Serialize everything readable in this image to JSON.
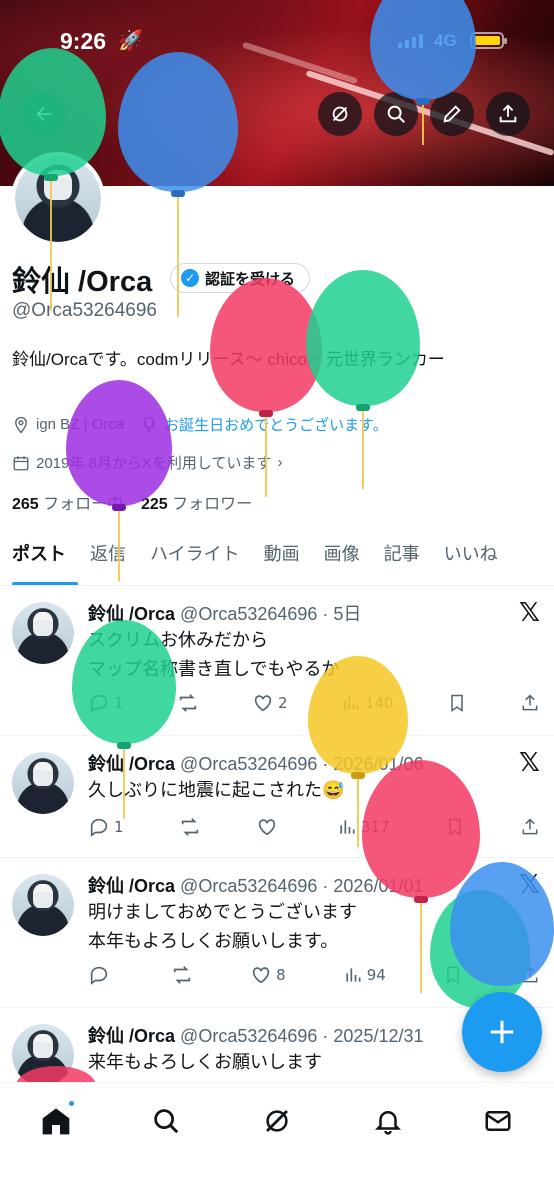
{
  "status_bar": {
    "time": "9:26",
    "network": "4G"
  },
  "profile": {
    "name": "鈴仙 /Orca",
    "verify_label": "認証を受ける",
    "handle": "@Orca53264696",
    "bio": "鈴仙/Orcaです。codmリリース〜 chicom 元世界ランカー",
    "location": "ign BZ | Orca",
    "birthday": "お誕生日おめでとうございます。",
    "joined": "2019年 8月からXを利用しています",
    "following_count": "265",
    "following_label": "フォロー中",
    "followers_count": "225",
    "followers_label": "フォロワー"
  },
  "tabs": [
    "ポスト",
    "返信",
    "ハイライト",
    "動画",
    "画像",
    "記事",
    "いいね"
  ],
  "posts": [
    {
      "name": "鈴仙 /Orca",
      "meta": "@Orca53264696 · 5日",
      "lines": [
        "スクリムお休みだから",
        "マップ名称書き直しでもやるか"
      ],
      "replies": "1",
      "likes": "2",
      "views": "140"
    },
    {
      "name": "鈴仙 /Orca",
      "meta": "@Orca53264696 · 2026/01/06",
      "lines": [
        "久しぶりに地震に起こされた😅"
      ],
      "replies": "1",
      "likes": "",
      "views": "317"
    },
    {
      "name": "鈴仙 /Orca",
      "meta": "@Orca53264696 · 2026/01/01",
      "lines": [
        "明けましておめでとうございます",
        "本年もよろしくお願いします。"
      ],
      "replies": "",
      "likes": "8",
      "views": "94"
    },
    {
      "name": "鈴仙 /Orca",
      "meta": "@Orca53264696 · 2025/12/31",
      "lines": [
        "来年もよろしくお願いします"
      ],
      "replies": "",
      "likes": "",
      "views": ""
    }
  ],
  "colors": {
    "accent": "#1d9bf0",
    "text": "#0f1419",
    "muted": "#536471"
  },
  "icons": {
    "back": "back-arrow-icon",
    "grok": "grok-icon",
    "search": "search-icon",
    "edit": "edit-icon",
    "share": "share-icon",
    "home": "home-icon",
    "notifications": "bell-icon",
    "messages": "mail-icon"
  }
}
